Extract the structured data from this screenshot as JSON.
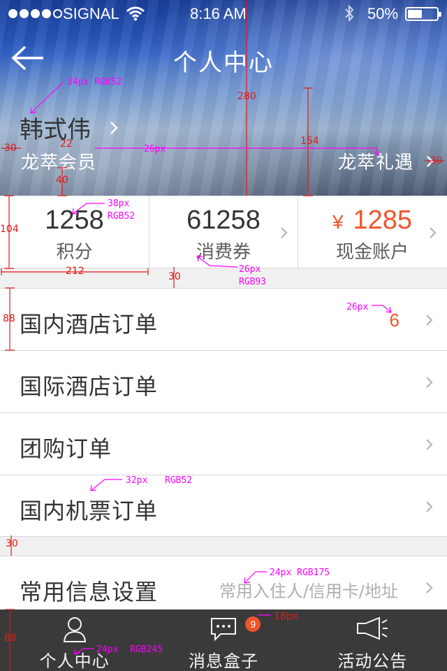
{
  "status_bar": {
    "carrier": "SIGNAL",
    "time": "8:16 AM",
    "battery": "50%",
    "battery_level": 0.5,
    "icons": [
      "signal-dots",
      "wifi-icon",
      "bluetooth-icon",
      "battery-icon"
    ]
  },
  "nav": {
    "title": "个人中心",
    "back_icon": "arrow-left-icon"
  },
  "profile": {
    "name": "韩式伟",
    "level": "龙萃会员",
    "perks": "龙萃礼遇"
  },
  "stats": [
    {
      "value": "1258",
      "label": "积分"
    },
    {
      "value": "61258",
      "label": "消费券"
    },
    {
      "currency": "¥",
      "value": "1285",
      "label": "现金账户"
    }
  ],
  "menu": [
    {
      "label": "国内酒店订单",
      "badge": "6"
    },
    {
      "label": "国际酒店订单"
    },
    {
      "label": "团购订单"
    },
    {
      "label": "国内机票订单"
    }
  ],
  "settings": {
    "label": "常用信息设置",
    "hint": "常用入住人/信用卡/地址"
  },
  "tab_bar": [
    {
      "label": "个人中心",
      "icon": "person-icon"
    },
    {
      "label": "消息盒子",
      "icon": "chat-bubble-icon",
      "badge": "9"
    },
    {
      "label": "活动公告",
      "icon": "megaphone-icon"
    }
  ],
  "colors": {
    "text_dark": "#343434",
    "text_mid": "#5d5d5d",
    "accent": "#f0542b",
    "hint": "#afafaf",
    "tab_bg": "#3a3a3a",
    "divider_bg": "#f0f0f0"
  },
  "annotations": {
    "name_spec": "34px  RGB52",
    "hero_height": "280",
    "hero_lower_height": "154",
    "left_margin": "30",
    "name_gap": "22",
    "text_size_26": "26px",
    "bottom_gap": "40",
    "right_margin": "30",
    "stats_height": "104",
    "stats_value_spec_1": "38px",
    "stats_value_spec_2": "RGB52",
    "stat_width": "212",
    "section_gap": "30",
    "label_spec_1": "26px",
    "label_spec_2": "RGB93",
    "row_height": "88",
    "badge_spec": "26px",
    "menu_spec_1": "32px",
    "menu_spec_2": "RGB52",
    "section_gap_2": "30",
    "hint_spec": "24px  RGB175",
    "badge_size": "18px",
    "tab_height": "88",
    "tab_spec_1": "24px",
    "tab_spec_2": "RGB245"
  }
}
